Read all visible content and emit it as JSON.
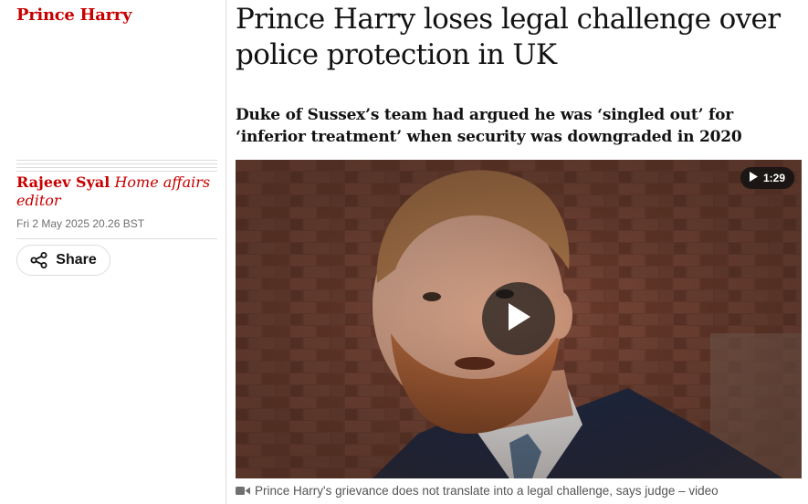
{
  "section": {
    "tag": "Prince Harry",
    "color": "#c70000"
  },
  "article": {
    "headline": "Prince Harry loses legal challenge over police protection in UK",
    "standfirst": "Duke of Sussex’s team had argued he was ‘singled out’ for ‘inferior treatment’ when security was downgraded in 2020"
  },
  "byline": {
    "author": "Rajeev Syal",
    "role": "Home affairs editor",
    "date": "Fri 2 May 2025 20.26 BST"
  },
  "share": {
    "label": "Share",
    "icon": "share-icon"
  },
  "media": {
    "duration": "1:29",
    "duration_icon": "play-small-icon",
    "play_icon": "play-icon",
    "caption": "Prince Harry's grievance does not translate into a legal challenge, says judge – video",
    "caption_icon": "video-camera-icon"
  }
}
